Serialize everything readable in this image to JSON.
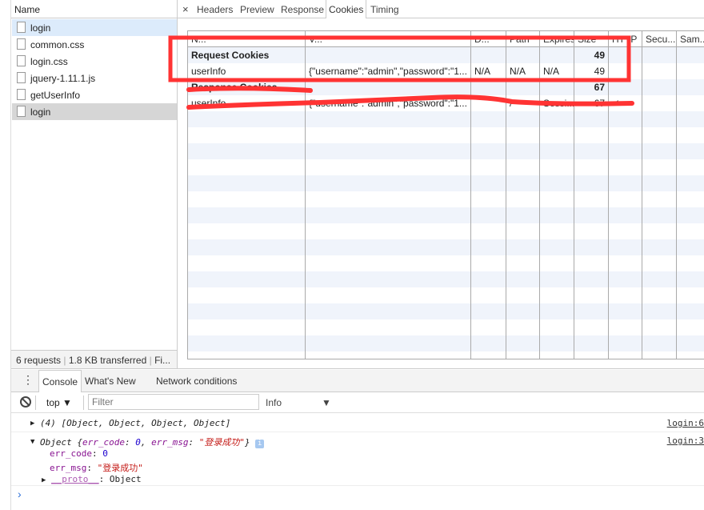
{
  "network": {
    "name_header": "Name",
    "files": [
      {
        "name": "login",
        "state": "selected"
      },
      {
        "name": "common.css",
        "state": ""
      },
      {
        "name": "login.css",
        "state": ""
      },
      {
        "name": "jquery-1.11.1.js",
        "state": ""
      },
      {
        "name": "getUserInfo",
        "state": ""
      },
      {
        "name": "login",
        "state": "active"
      }
    ],
    "status": {
      "requests": "6 requests",
      "transferred": "1.8 KB transferred",
      "finish": "Fi..."
    }
  },
  "detail": {
    "close": "×",
    "tabs": [
      "Headers",
      "Preview",
      "Response",
      "Cookies",
      "Timing"
    ],
    "active_tab": "Cookies",
    "columns": [
      "N...",
      "V...",
      "D...",
      "Path",
      "Expires",
      "Size",
      "HTTP",
      "Secu...",
      "Sam..."
    ],
    "rows": [
      {
        "name": "Request Cookies",
        "size": "49",
        "group": true
      },
      {
        "name": "userInfo",
        "value": "{\"username\":\"admin\",\"password\":\"1...",
        "domain": "N/A",
        "path": "N/A",
        "expires": "N/A",
        "size": "49"
      },
      {
        "name": "Response Cookies",
        "size": "67",
        "group": true
      },
      {
        "name": "userInfo",
        "value": "{\"username\":\"admin\",\"password\":\"1...",
        "path": "/",
        "expires": "Sessi...",
        "size": "67",
        "http": "✓"
      }
    ],
    "annotation_color": "#ff3333"
  },
  "console": {
    "tabs": [
      "Console",
      "What's New",
      "Network conditions"
    ],
    "context": "top",
    "filter_placeholder": "Filter",
    "level": "Info",
    "messages": [
      {
        "text": "(4) [Object, Object, Object, Object]",
        "source": "login:6"
      },
      {
        "summary_prefix": "Object {",
        "k1": "err_code",
        "v1": "0",
        "k2": "err_msg",
        "v2": "\"登录成功\"",
        "suffix": "}",
        "source": "login:3",
        "props": [
          {
            "key": "err_code",
            "value": "0"
          },
          {
            "key": "err_msg",
            "value": "\"登录成功\""
          },
          {
            "key": "__proto__",
            "value": "Object"
          }
        ]
      }
    ],
    "prompt": "›"
  }
}
